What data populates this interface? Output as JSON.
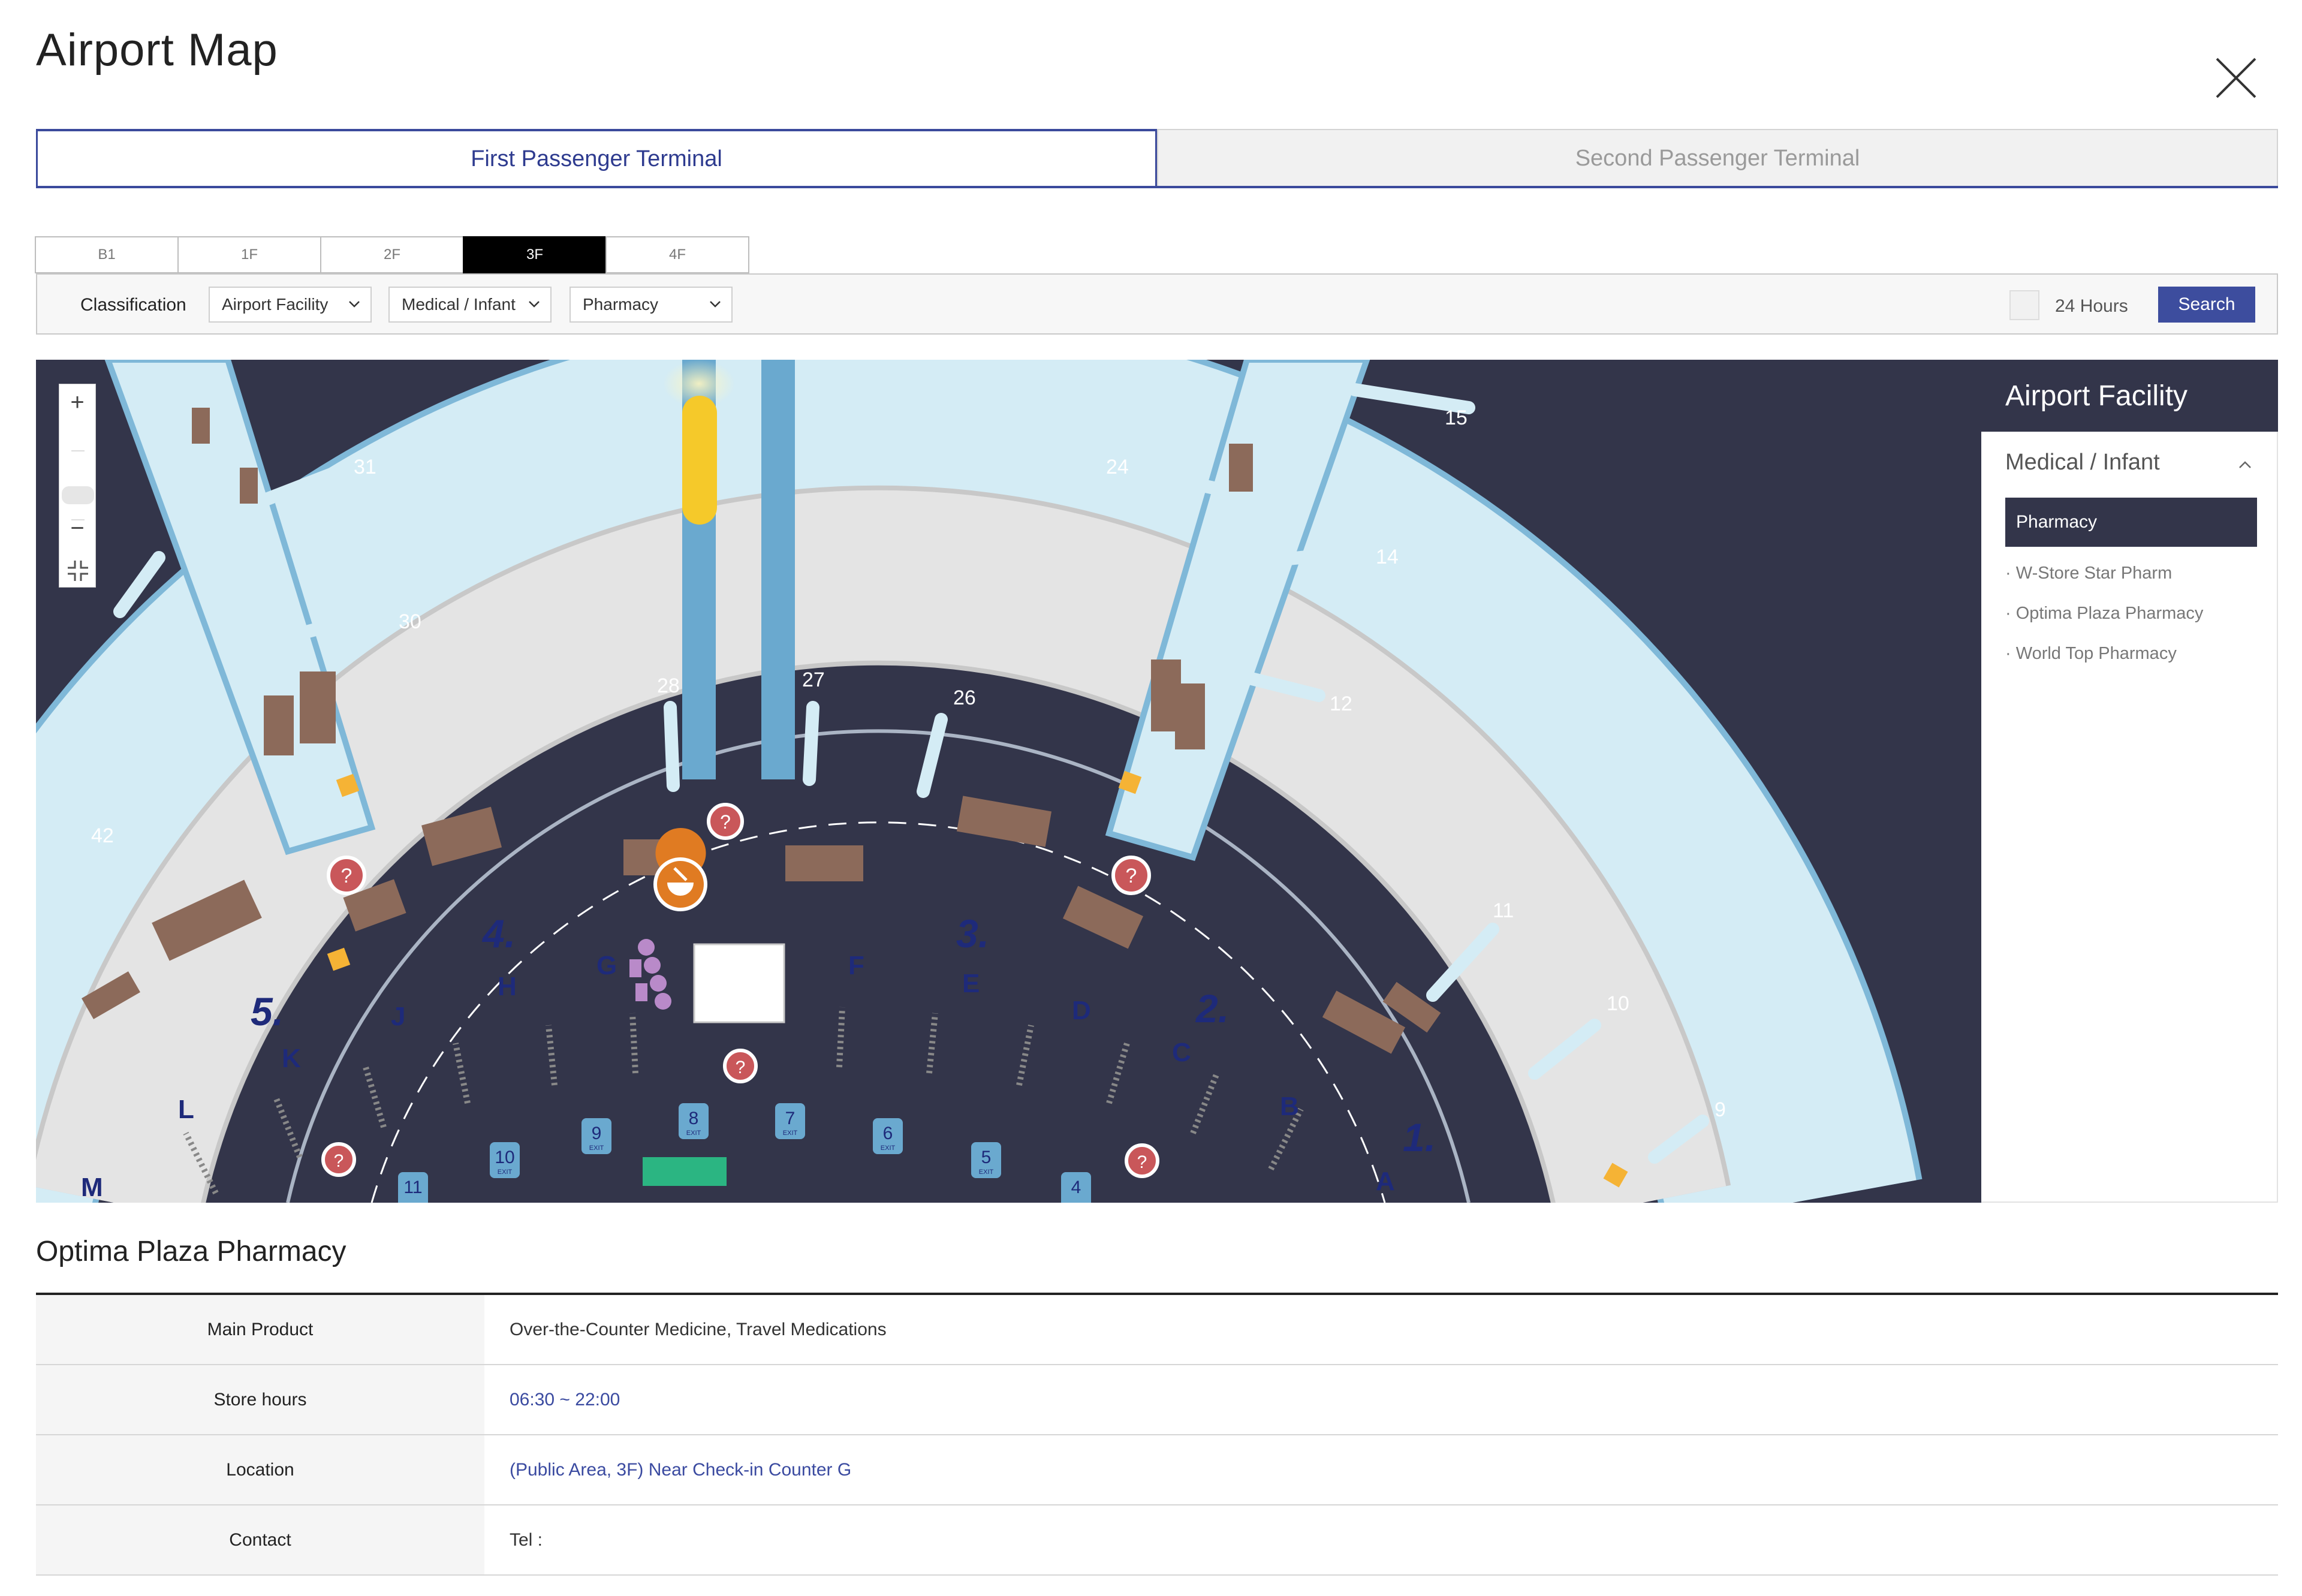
{
  "page": {
    "title": "Airport Map"
  },
  "terminals": [
    {
      "label": "First Passenger Terminal",
      "active": true
    },
    {
      "label": "Second Passenger Terminal",
      "active": false
    }
  ],
  "floors": [
    {
      "label": "B1",
      "active": false
    },
    {
      "label": "1F",
      "active": false
    },
    {
      "label": "2F",
      "active": false
    },
    {
      "label": "3F",
      "active": true
    },
    {
      "label": "4F",
      "active": false
    }
  ],
  "filter": {
    "label": "Classification",
    "selects": [
      "Airport Facility",
      "Medical / Infant",
      "Pharmacy"
    ],
    "checkbox_label": "24 Hours",
    "search_label": "Search"
  },
  "map": {
    "zoom_in": "+",
    "zoom_out": "−",
    "gate_numbers": [
      "31",
      "30",
      "42",
      "28",
      "27",
      "26",
      "24",
      "15",
      "14",
      "12",
      "11",
      "10",
      "9"
    ],
    "check_in_rows": [
      "M",
      "L",
      "K",
      "J",
      "H",
      "G",
      "F",
      "E",
      "D",
      "C",
      "B",
      "A"
    ],
    "zones": [
      "5.",
      "4.",
      "3.",
      "2.",
      "1."
    ],
    "exits": [
      "11",
      "10",
      "9",
      "8",
      "7",
      "6",
      "5",
      "4"
    ],
    "exit_label": "EXIT",
    "colors": {
      "background": "#33354a",
      "concourse": "#d4ecf5",
      "check_in_area": "#e4e4e4",
      "shop": "#8c6a5a",
      "pharmacy_marker": "#e07b22",
      "info_marker": "#c9575a"
    }
  },
  "sidebar": {
    "heading": "Airport Facility",
    "category": "Medical / Infant",
    "selected": "Pharmacy",
    "items": [
      "W-Store Star Pharm",
      "Optima Plaza Pharmacy",
      "World Top Pharmacy"
    ]
  },
  "detail": {
    "name": "Optima Plaza Pharmacy",
    "rows": [
      {
        "label": "Main Product",
        "value": "Over-the-Counter Medicine, Travel Medications"
      },
      {
        "label": "Store hours",
        "value": "06:30 ~ 22:00"
      },
      {
        "label": "Location",
        "value": "(Public Area, 3F) Near Check-in Counter G"
      },
      {
        "label": "Contact",
        "value": "Tel :"
      }
    ]
  }
}
